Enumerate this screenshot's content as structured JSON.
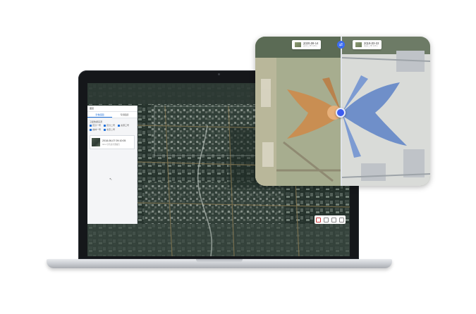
{
  "app": {
    "sidebar": {
      "header": "图层",
      "tabs": [
        {
          "label": "影像底图",
          "active": true
        },
        {
          "label": "专题图层",
          "active": false
        }
      ],
      "section_label": "卫星数据来源",
      "checks": [
        "高分一号",
        "高分二号",
        "资源三号",
        "吉林一号",
        "北京二号"
      ],
      "card": {
        "title": "2018-06-07 09:10:05",
        "subtitle": "GF-2 全色多光谱融合"
      }
    },
    "compare": {
      "left_date": {
        "title": "2020-08-14",
        "subtitle": "高分二号 0.8m"
      },
      "right_date": {
        "title": "2019-03-22",
        "subtitle": "北京二号 0.8m"
      },
      "divider_icon": "swap-icon",
      "handle_icon": "swipe-handle-icon"
    },
    "colors": {
      "accent": "#3c5cf0",
      "sidebar_bg": "#f4f5f7",
      "laptop_bezel": "#15171a"
    }
  }
}
